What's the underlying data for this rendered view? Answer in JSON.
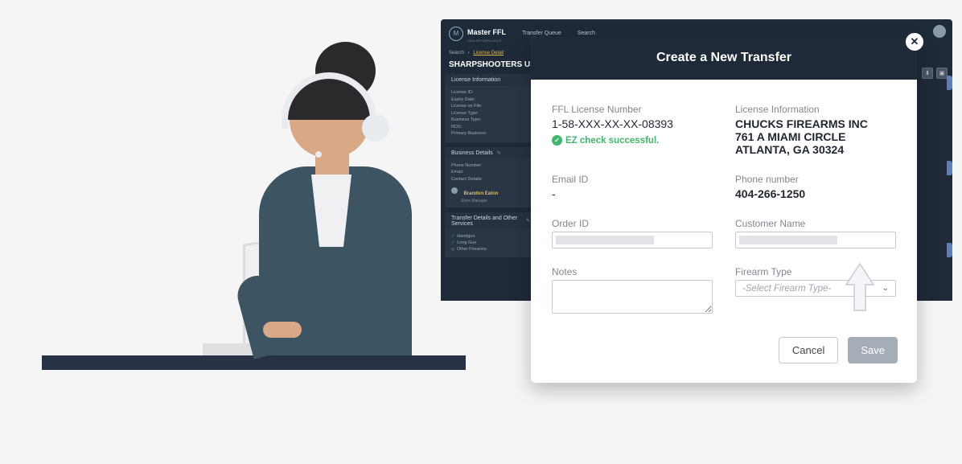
{
  "header": {
    "brand_name": "Master FFL",
    "brand_sub": "DEALERCOMPLIANCE",
    "nav": {
      "transfer_queue": "Transfer Queue",
      "search": "Search"
    }
  },
  "breadcrumb": {
    "root": "Search",
    "current": "License Detail"
  },
  "company": {
    "name": "SHARPSHOOTERS USA"
  },
  "left_panel": {
    "license_info": {
      "title": "License Information",
      "rows": [
        "License ID:",
        "Expiry Date:",
        "License on File:",
        "License Type:",
        "Business Type:",
        "RDS:",
        "Primary Business:"
      ]
    },
    "business_details": {
      "title": "Business Details",
      "rows": [
        "Phone Number:",
        "Email:",
        "Contact Details:"
      ],
      "contact_name": "Brandon Eaton",
      "contact_role": "Store Manager"
    },
    "transfer_details": {
      "title": "Transfer Details and Other Services",
      "items": [
        "Handgun",
        "Long Gun",
        "Other Firearms"
      ]
    }
  },
  "modal": {
    "title": "Create a New Transfer",
    "ffl_label": "FFL License Number",
    "ffl_value": "1-58-XXX-XX-XX-08393",
    "ez_check": "EZ check successful.",
    "license_info_label": "License Information",
    "license_name": "CHUCKS FIREARMS INC",
    "license_addr1": "761 A MIAMI CIRCLE",
    "license_addr2": "ATLANTA, GA 30324",
    "email_label": "Email ID",
    "email_value": "-",
    "phone_label": "Phone number",
    "phone_value": "404-266-1250",
    "order_label": "Order ID",
    "customer_label": "Customer Name",
    "notes_label": "Notes",
    "firearm_type_label": "Firearm Type",
    "firearm_type_placeholder": "-Select Firearm Type-",
    "cancel": "Cancel",
    "save": "Save"
  }
}
